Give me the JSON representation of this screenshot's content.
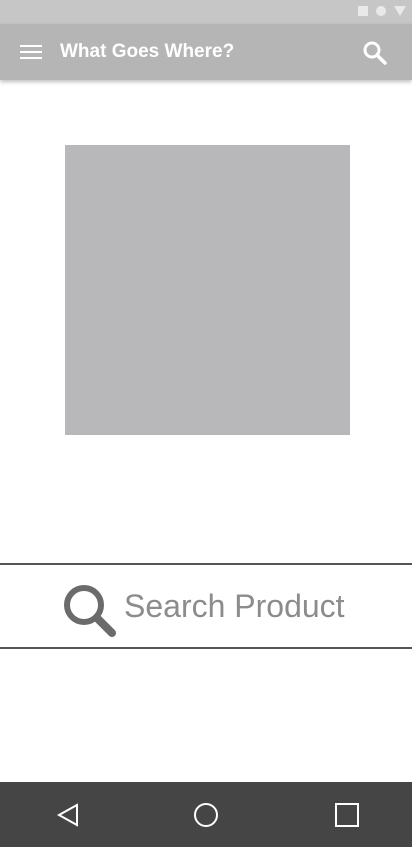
{
  "app_bar": {
    "title": "What Goes Where?",
    "menu_icon": "hamburger-menu-icon",
    "search_icon": "search-icon"
  },
  "status_bar": {
    "icons": [
      "square-icon",
      "circle-icon",
      "triangle-down-icon"
    ]
  },
  "hero": {
    "image": "placeholder-image"
  },
  "search": {
    "placeholder": "Search Product",
    "icon": "search-icon"
  },
  "nav_bar": {
    "icons": [
      "back-icon",
      "home-icon",
      "recent-apps-icon"
    ]
  },
  "colors": {
    "status_bar": "#c6c6c6",
    "app_bar": "#b5b5b5",
    "image_placeholder": "#b8b7b9",
    "search_text": "#8c8c8c",
    "nav_bar": "#464546"
  }
}
